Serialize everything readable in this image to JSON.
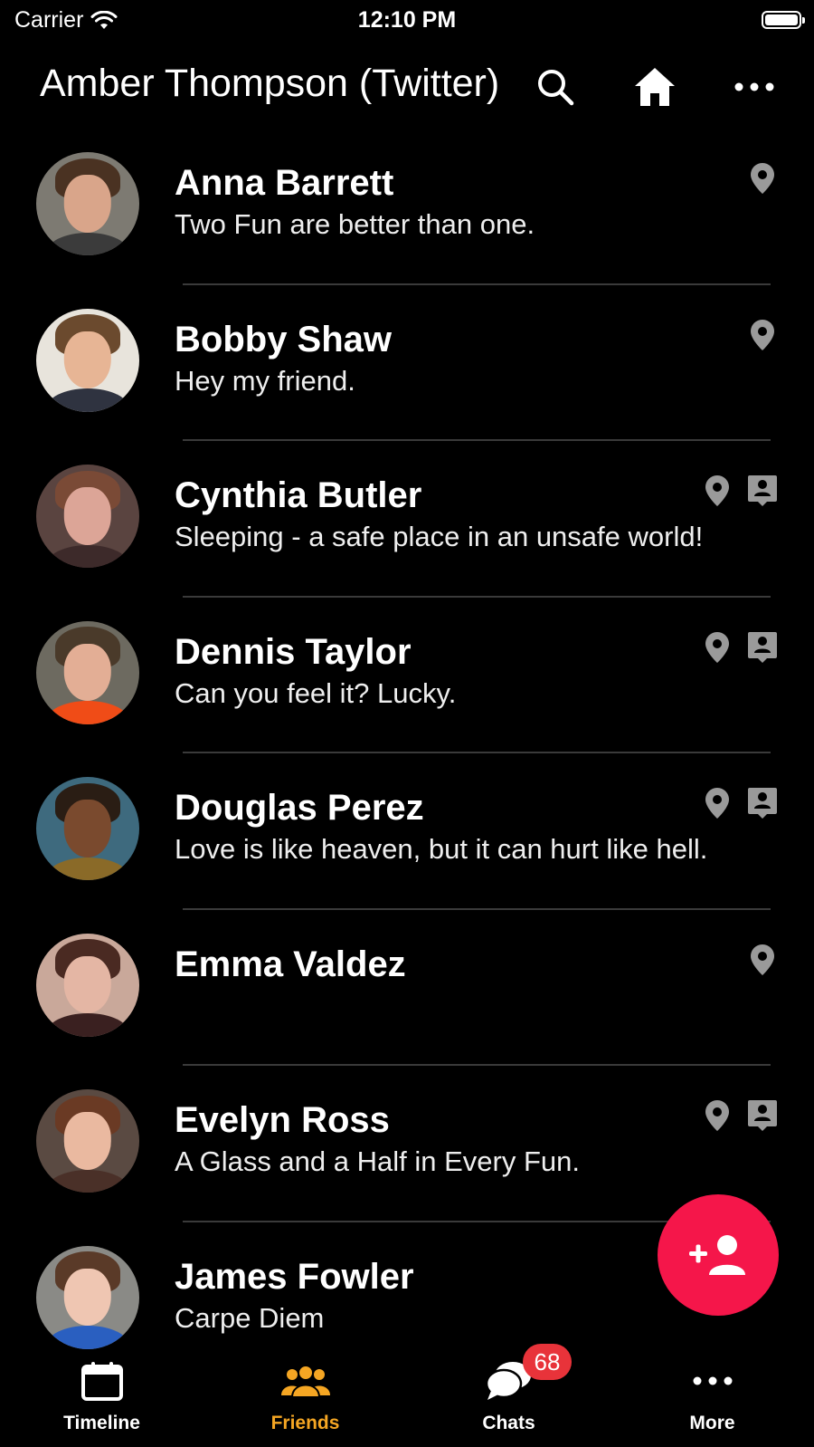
{
  "status_bar": {
    "carrier": "Carrier",
    "time": "12:10 PM"
  },
  "header": {
    "title": "Amber Thompson (Twitter)",
    "search_icon": "search-icon",
    "home_icon": "home-icon",
    "more_icon": "more-horizontal-icon"
  },
  "colors": {
    "accent": "#f5a623",
    "fab": "#f5164a",
    "badge": "#e8333a",
    "icon_gray": "#9a9a9a"
  },
  "friends": [
    {
      "name": "Anna Barrett",
      "status": "Two Fun are better than one.",
      "icons": [
        "location-pin-icon"
      ]
    },
    {
      "name": "Bobby Shaw",
      "status": "Hey my friend.",
      "icons": [
        "location-pin-icon"
      ]
    },
    {
      "name": "Cynthia Butler",
      "status": "Sleeping - a safe place in an unsafe world!",
      "icons": [
        "location-pin-icon",
        "contact-card-icon"
      ]
    },
    {
      "name": "Dennis Taylor",
      "status": "Can you feel it? Lucky.",
      "icons": [
        "location-pin-icon",
        "contact-card-icon"
      ]
    },
    {
      "name": "Douglas Perez",
      "status": "Love is like heaven, but it can hurt like hell.",
      "icons": [
        "location-pin-icon",
        "contact-card-icon"
      ]
    },
    {
      "name": "Emma Valdez",
      "status": "",
      "icons": [
        "location-pin-icon"
      ]
    },
    {
      "name": "Evelyn Ross",
      "status": "A Glass and a Half in Every Fun.",
      "icons": [
        "location-pin-icon",
        "contact-card-icon"
      ]
    },
    {
      "name": "James Fowler",
      "status": "Carpe Diem",
      "icons": []
    }
  ],
  "fab": {
    "icon": "add-friend-icon"
  },
  "tabs": [
    {
      "label": "Timeline",
      "icon": "calendar-icon",
      "active": false
    },
    {
      "label": "Friends",
      "icon": "people-icon",
      "active": true
    },
    {
      "label": "Chats",
      "icon": "chat-bubbles-icon",
      "active": false,
      "badge": "68"
    },
    {
      "label": "More",
      "icon": "more-horizontal-icon",
      "active": false
    }
  ]
}
